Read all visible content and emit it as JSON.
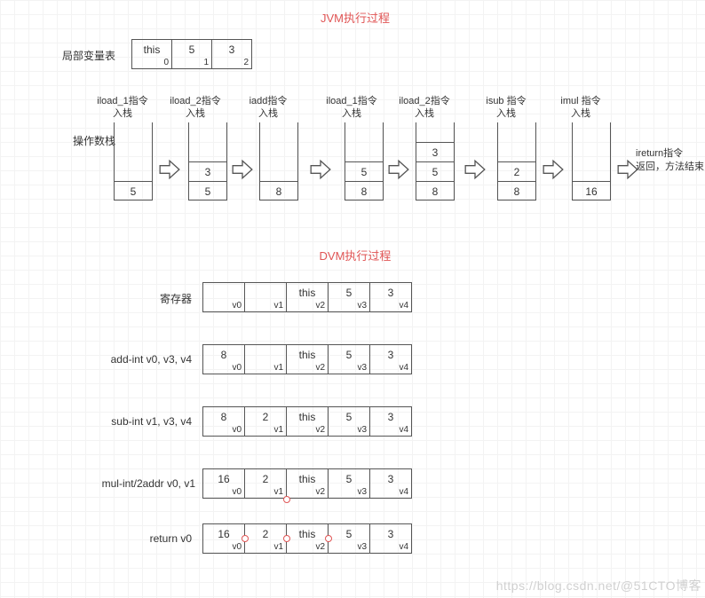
{
  "titles": {
    "jvm": "JVM执行过程",
    "dvm": "DVM执行过程"
  },
  "labels": {
    "localVars": "局部变量表",
    "opStack": "操作数栈",
    "registers": "寄存器"
  },
  "localVarTable": [
    {
      "val": "this",
      "idx": "0"
    },
    {
      "val": "5",
      "idx": "1"
    },
    {
      "val": "3",
      "idx": "2"
    }
  ],
  "stackNotes": [
    "iload_1指令\n入栈",
    "iload_2指令\n入栈",
    "iadd指令\n入栈",
    "iload_1指令\n入栈",
    "iload_2指令\n入栈",
    "isub 指令\n入栈",
    "imul  指令\n入栈"
  ],
  "returnNote": "ireturn指令\n返回，方法结束",
  "stacks": [
    {
      "cells": [
        "5"
      ]
    },
    {
      "cells": [
        "3",
        "5"
      ]
    },
    {
      "cells": [
        "8"
      ]
    },
    {
      "cells": [
        "5",
        "8"
      ]
    },
    {
      "cells": [
        "3",
        "5",
        "8"
      ]
    },
    {
      "cells": [
        "2",
        "8"
      ]
    },
    {
      "cells": [
        "16"
      ]
    }
  ],
  "dvm": [
    {
      "label": "",
      "cells": [
        {
          "val": "",
          "idx": "v0"
        },
        {
          "val": "",
          "idx": "v1"
        },
        {
          "val": "this",
          "idx": "v2"
        },
        {
          "val": "5",
          "idx": "v3"
        },
        {
          "val": "3",
          "idx": "v4"
        }
      ]
    },
    {
      "label": "add-int  v0, v3, v4",
      "cells": [
        {
          "val": "8",
          "idx": "v0"
        },
        {
          "val": "",
          "idx": "v1"
        },
        {
          "val": "this",
          "idx": "v2"
        },
        {
          "val": "5",
          "idx": "v3"
        },
        {
          "val": "3",
          "idx": "v4"
        }
      ]
    },
    {
      "label": "sub-int  v1, v3, v4",
      "cells": [
        {
          "val": "8",
          "idx": "v0"
        },
        {
          "val": "2",
          "idx": "v1"
        },
        {
          "val": "this",
          "idx": "v2"
        },
        {
          "val": "5",
          "idx": "v3"
        },
        {
          "val": "3",
          "idx": "v4"
        }
      ]
    },
    {
      "label": "mul-int/2addr  v0, v1",
      "cells": [
        {
          "val": "16",
          "idx": "v0"
        },
        {
          "val": "2",
          "idx": "v1"
        },
        {
          "val": "this",
          "idx": "v2"
        },
        {
          "val": "5",
          "idx": "v3"
        },
        {
          "val": "3",
          "idx": "v4"
        }
      ]
    },
    {
      "label": "return  v0",
      "cells": [
        {
          "val": "16",
          "idx": "v0"
        },
        {
          "val": "2",
          "idx": "v1"
        },
        {
          "val": "this",
          "idx": "v2"
        },
        {
          "val": "5",
          "idx": "v3"
        },
        {
          "val": "3",
          "idx": "v4"
        }
      ]
    }
  ],
  "watermark": "https://blog.csdn.net/@51CTO博客"
}
